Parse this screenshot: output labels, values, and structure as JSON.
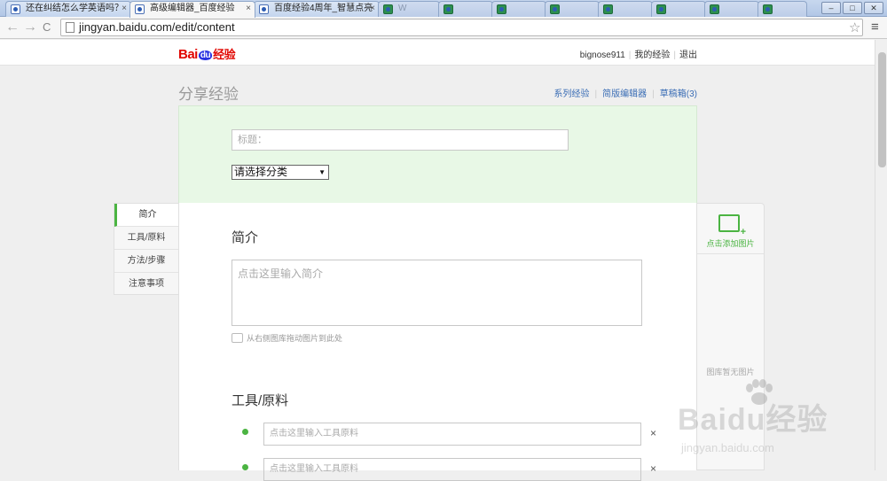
{
  "browser": {
    "tabs": [
      {
        "title": "还在纠结怎么学英语吗？",
        "active": false
      },
      {
        "title": "高级编辑器_百度经验",
        "active": true
      },
      {
        "title": "百度经验4周年_智慧点亮",
        "active": false
      }
    ],
    "faded_tabs": [
      "W",
      "",
      "",
      "",
      "",
      "",
      ""
    ],
    "url": "jingyan.baidu.com/edit/content",
    "back_icon": "←",
    "forward_icon": "→",
    "reload_icon": "C",
    "star_icon": "☆",
    "menu_icon": "≡",
    "win_min": "–",
    "win_max": "□",
    "win_close": "✕",
    "tab_close": "×"
  },
  "site": {
    "logo_bai": "Bai",
    "logo_du": "du",
    "logo_jy": "经验",
    "user": {
      "username": "bignose911",
      "my_experience": "我的经验",
      "logout": "退出"
    }
  },
  "page": {
    "title": "分享经验",
    "editor_links": {
      "series": "系列经验",
      "simple_editor": "简版编辑器",
      "drafts": "草稿箱(3)"
    }
  },
  "form": {
    "title_placeholder": "标题：",
    "category_label": "请选择分类",
    "category_arrow": "▼"
  },
  "left_nav": {
    "items": [
      "简介",
      "工具/原料",
      "方法/步骤",
      "注意事项"
    ]
  },
  "content": {
    "intro_heading": "简介",
    "intro_placeholder": "点击这里输入简介",
    "drag_hint": "从右侧图库拖动图片到此处",
    "tools_heading": "工具/原料",
    "tool_placeholder_1": "点击这里输入工具原料",
    "tool_placeholder_2": "点击这里输入工具原料",
    "remove_icon": "×"
  },
  "image_panel": {
    "add_image": "点击添加图片",
    "empty_text": "图库暂无图片"
  },
  "watermark": {
    "text": "Baidu经验",
    "url": "jingyan.baidu.com"
  },
  "colors": {
    "accent_green": "#4bb442",
    "link_blue": "#3a6db5",
    "title_panel_bg": "#e8f8e6"
  }
}
